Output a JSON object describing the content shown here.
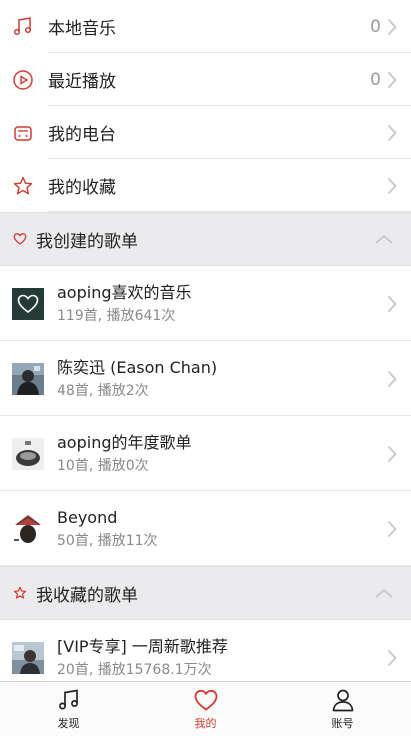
{
  "menu": [
    {
      "label": "本地音乐",
      "count": "0"
    },
    {
      "label": "最近播放",
      "count": "0"
    },
    {
      "label": "我的电台",
      "count": ""
    },
    {
      "label": "我的收藏",
      "count": ""
    }
  ],
  "created_section": {
    "title": "我创建的歌单",
    "playlists": [
      {
        "name": "aoping喜欢的音乐",
        "meta": "119首, 播放641次"
      },
      {
        "name": "陈奕迅 (Eason Chan)",
        "meta": "48首, 播放2次"
      },
      {
        "name": "aoping的年度歌单",
        "meta": "10首, 播放0次"
      },
      {
        "name": "Beyond",
        "meta": "50首, 播放11次"
      }
    ]
  },
  "collected_section": {
    "title": "我收藏的歌单",
    "playlists": [
      {
        "name": "[VIP专享] 一周新歌推荐",
        "meta": "20首, 播放15768.1万次"
      }
    ]
  },
  "tabbar": {
    "tabs": [
      {
        "label": "发现",
        "icon": "music-note-icon",
        "active": false
      },
      {
        "label": "我的",
        "icon": "heart-icon",
        "active": true
      },
      {
        "label": "账号",
        "icon": "person-icon",
        "active": false
      }
    ]
  },
  "colors": {
    "accent": "#d33a31",
    "section_bg": "#ebebed",
    "chevron": "#c7c7cc"
  }
}
